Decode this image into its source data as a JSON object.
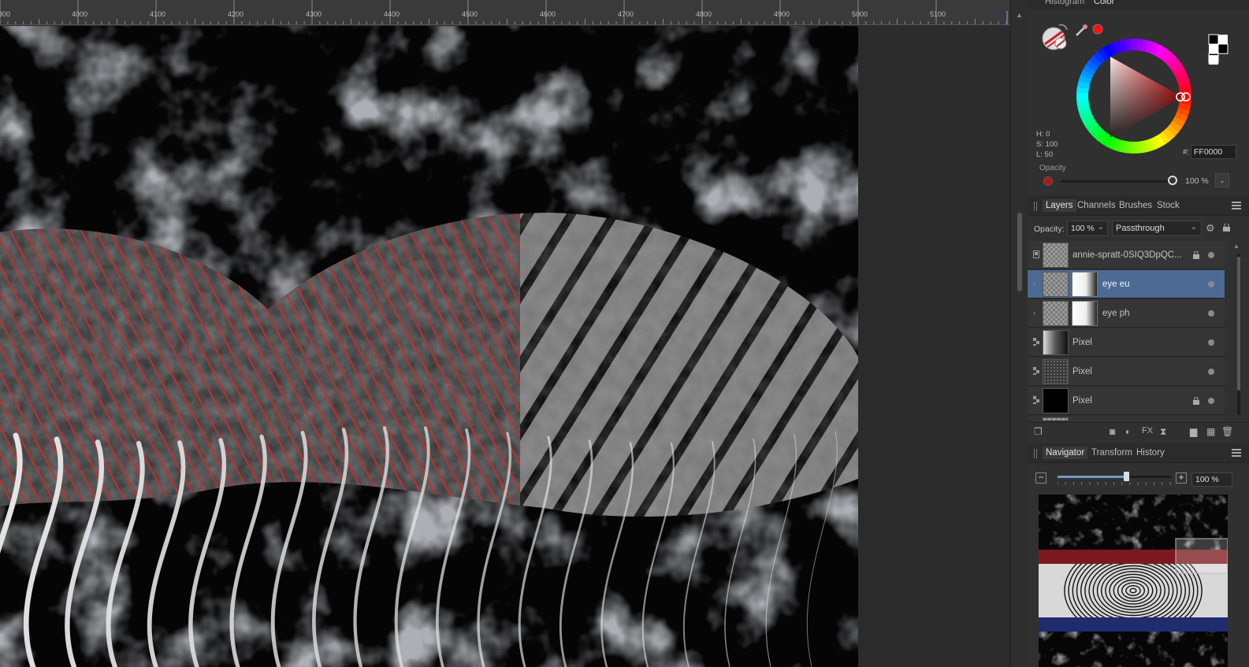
{
  "ruler": {
    "labels": [
      "300",
      "4000",
      "4100",
      "4200",
      "4300",
      "4400",
      "4500",
      "4600",
      "4700",
      "4800",
      "4900",
      "5000",
      "5100"
    ]
  },
  "color_panel": {
    "tabs": [
      "Histogram",
      "Color"
    ],
    "hsl": {
      "h": "H: 0",
      "s": "S: 100",
      "l": "L: 50"
    },
    "hex_label": "#:",
    "hex_value": "FF0000",
    "opacity_label": "Opacity",
    "opacity_value": "100 %",
    "current_color": "#ff0000"
  },
  "layers_panel": {
    "tabs": [
      "Layers",
      "Channels",
      "Brushes",
      "Stock"
    ],
    "opacity_label": "Opacity:",
    "opacity_value": "100 %",
    "blend_mode": "Passthrough",
    "layers": [
      {
        "name": "annie-spratt-0SIQ3DpQC...",
        "selected": false,
        "has_mask": false,
        "locked": true
      },
      {
        "name": "eye eu",
        "selected": true,
        "has_mask": true,
        "locked": false
      },
      {
        "name": "eye ph",
        "selected": false,
        "has_mask": true,
        "locked": false
      },
      {
        "name": "Pixel",
        "selected": false,
        "has_mask": false,
        "locked": false
      },
      {
        "name": "Pixel",
        "selected": false,
        "has_mask": false,
        "locked": false
      },
      {
        "name": "Pixel",
        "selected": false,
        "has_mask": false,
        "locked": true
      }
    ]
  },
  "navigator_panel": {
    "tabs": [
      "Navigator",
      "Transform",
      "History"
    ],
    "zoom_value": "100 %",
    "minus_label": "−",
    "plus_label": "+"
  },
  "colors": {
    "selection_blue": "#4c6a93",
    "accent_red": "#ff0000"
  }
}
